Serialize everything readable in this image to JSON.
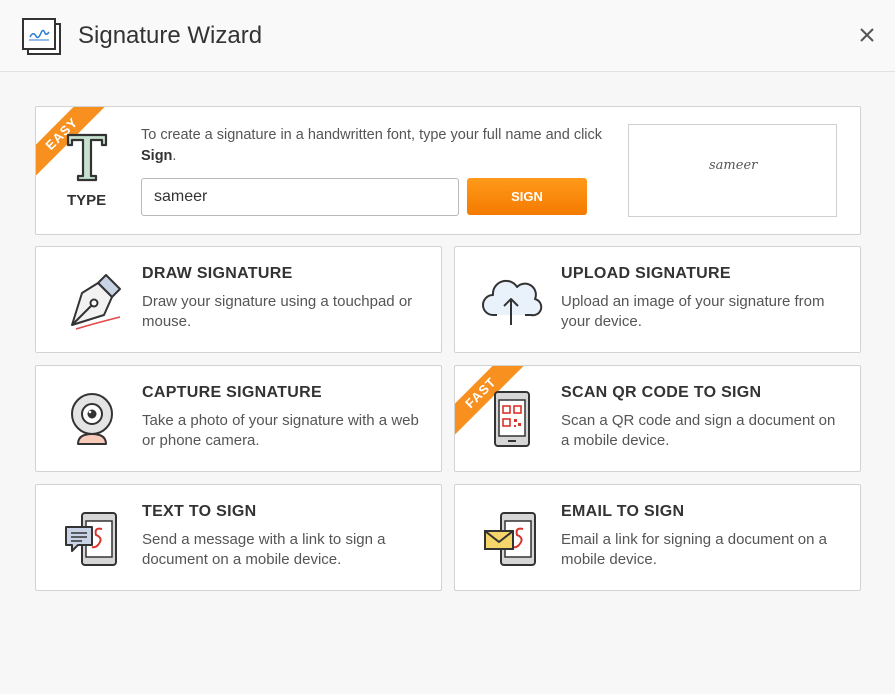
{
  "header": {
    "title": "Signature Wizard",
    "app_icon": "signature-app-icon",
    "close_icon": "close-icon"
  },
  "type_card": {
    "badge": "EASY",
    "label": "TYPE",
    "desc_prefix": "To create a signature in a handwritten font, type your full name and click ",
    "desc_bold": "Sign",
    "desc_suffix": ".",
    "input_value": "sameer",
    "button_label": "SIGN",
    "preview_text": "sameer"
  },
  "options": [
    {
      "title": "DRAW SIGNATURE",
      "desc": "Draw your signature using a touchpad or mouse.",
      "icon": "pen-nib-icon"
    },
    {
      "title": "UPLOAD SIGNATURE",
      "desc": "Upload an image of your signature from your device.",
      "icon": "cloud-upload-icon"
    },
    {
      "title": "CAPTURE SIGNATURE",
      "desc": "Take a photo of your signature with a web or phone camera.",
      "icon": "webcam-icon"
    },
    {
      "title": "SCAN QR CODE TO SIGN",
      "desc": "Scan a QR code and sign a document on a mobile device.",
      "icon": "qr-phone-icon",
      "badge": "FAST"
    },
    {
      "title": "TEXT TO SIGN",
      "desc": "Send a message with a link to sign a document on a mobile device.",
      "icon": "sms-phone-icon"
    },
    {
      "title": "EMAIL TO SIGN",
      "desc": "Email a link for signing a document on a mobile device.",
      "icon": "email-phone-icon"
    }
  ],
  "colors": {
    "accent": "#f7901e",
    "button": "#f47a00",
    "border": "#d3d3d3"
  }
}
